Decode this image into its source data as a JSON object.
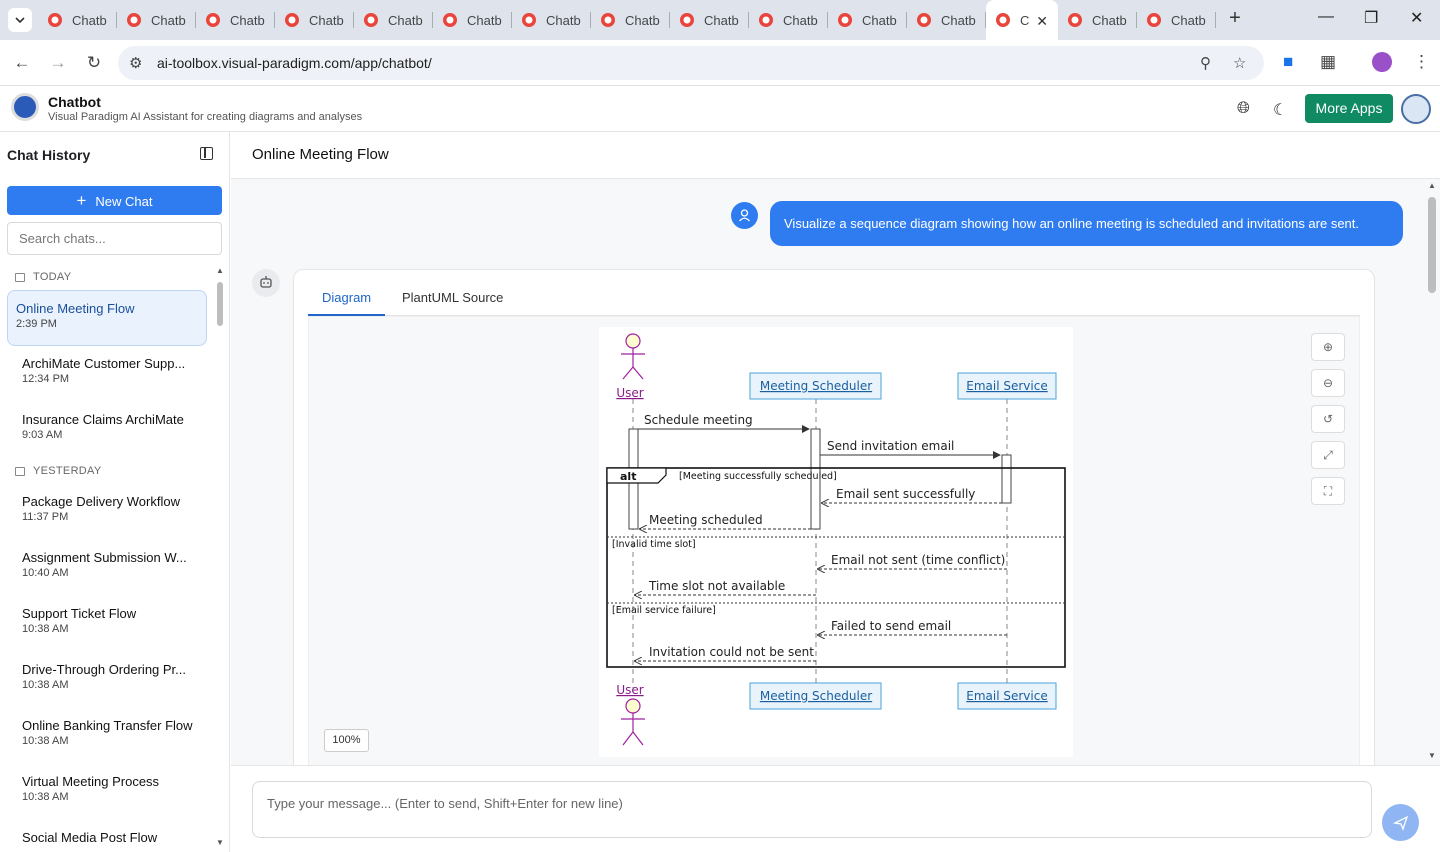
{
  "browser": {
    "tabs": [
      {
        "label": "Chatb"
      },
      {
        "label": "Chatb"
      },
      {
        "label": "Chatb"
      },
      {
        "label": "Chatb"
      },
      {
        "label": "Chatb"
      },
      {
        "label": "Chatb"
      },
      {
        "label": "Chatb"
      },
      {
        "label": "Chatb"
      },
      {
        "label": "Chatb"
      },
      {
        "label": "Chatb"
      },
      {
        "label": "Chatb"
      },
      {
        "label": "Chatb"
      },
      {
        "label": "C",
        "active": true
      },
      {
        "label": "Chatb"
      },
      {
        "label": "Chatb"
      }
    ],
    "url": "ai-toolbox.visual-paradigm.com/app/chatbot/"
  },
  "app": {
    "title": "Chatbot",
    "subtitle": "Visual Paradigm AI Assistant for creating diagrams and analyses",
    "more_apps": "More Apps"
  },
  "sidebar": {
    "title": "Chat History",
    "new_chat": "New Chat",
    "search_placeholder": "Search chats...",
    "groups": [
      {
        "label": "TODAY",
        "items": [
          {
            "name": "Online Meeting Flow",
            "time": "2:39 PM",
            "active": true
          },
          {
            "name": "ArchiMate Customer Supp...",
            "time": "12:34 PM"
          },
          {
            "name": "Insurance Claims ArchiMate",
            "time": "9:03 AM"
          }
        ]
      },
      {
        "label": "YESTERDAY",
        "items": [
          {
            "name": "Package Delivery Workflow",
            "time": "11:37 PM"
          },
          {
            "name": "Assignment Submission W...",
            "time": "10:40 AM"
          },
          {
            "name": "Support Ticket Flow",
            "time": "10:38 AM"
          },
          {
            "name": "Drive-Through Ordering Pr...",
            "time": "10:38 AM"
          },
          {
            "name": "Online Banking Transfer Flow",
            "time": "10:38 AM"
          },
          {
            "name": "Virtual Meeting Process",
            "time": "10:38 AM"
          },
          {
            "name": "Social Media Post Flow",
            "time": ""
          }
        ]
      }
    ]
  },
  "main": {
    "title": "Online Meeting Flow",
    "user_message": "Visualize a sequence diagram showing how an online meeting is scheduled and invitations are sent.",
    "tabs": [
      "Diagram",
      "PlantUML Source"
    ],
    "zoom_level": "100%",
    "input_placeholder": "Type your message... (Enter to send, Shift+Enter for new line)"
  },
  "diagram": {
    "participants": [
      "User",
      "Meeting Scheduler",
      "Email Service"
    ],
    "messages": [
      {
        "label": "Schedule meeting"
      },
      {
        "label": "Send invitation email"
      },
      {
        "label": "Email sent successfully"
      },
      {
        "label": "Meeting scheduled"
      },
      {
        "label": "Email not sent (time conflict)"
      },
      {
        "label": "Time slot not available"
      },
      {
        "label": "Failed to send email"
      },
      {
        "label": "Invitation could not be sent"
      }
    ],
    "fragment": {
      "operator": "alt",
      "guards": [
        "[Meeting successfully scheduled]",
        "[Invalid time slot]",
        "[Email service failure]"
      ]
    },
    "colors": {
      "actor": "#a80036",
      "participant_fill": "#fefece",
      "participant_border": "#a80036"
    }
  }
}
